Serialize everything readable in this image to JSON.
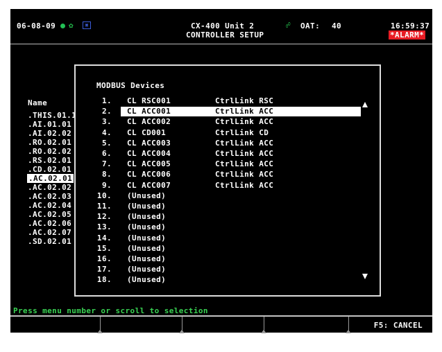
{
  "header": {
    "date": "06-08-09",
    "unit_title": "CX-400 Unit 2",
    "screen_title": "CONTROLLER SETUP",
    "oat_label": "OAT:",
    "oat_value": "40",
    "time": "16:59:37",
    "alarm": "*ALARM*"
  },
  "background": {
    "name_label": "Name",
    "names": [
      ".THIS.01.1",
      ".AI.01.01",
      ".AI.02.02",
      ".RO.02.01",
      ".RO.02.02",
      ".RS.02.01",
      ".CD.02.01",
      ".AC.02.01",
      ".AC.02.02",
      ".AC.02.03",
      ".AC.02.04",
      ".AC.02.05",
      ".AC.02.06",
      ".AC.02.07",
      ".SD.02.01"
    ],
    "selected_index": 7
  },
  "dialog": {
    "title": "MODBUS Devices",
    "selected_index": 1,
    "devices": [
      {
        "num": "1.",
        "name": "CL RSC001",
        "type": "CtrlLink RSC"
      },
      {
        "num": "2.",
        "name": "CL ACC001",
        "type": "CtrlLink ACC"
      },
      {
        "num": "3.",
        "name": "CL ACC002",
        "type": "CtrlLink ACC"
      },
      {
        "num": "4.",
        "name": "CL CD001",
        "type": "CtrlLink CD"
      },
      {
        "num": "5.",
        "name": "CL ACC003",
        "type": "CtrlLink ACC"
      },
      {
        "num": "6.",
        "name": "CL ACC004",
        "type": "CtrlLink ACC"
      },
      {
        "num": "7.",
        "name": "CL ACC005",
        "type": "CtrlLink ACC"
      },
      {
        "num": "8.",
        "name": "CL ACC006",
        "type": "CtrlLink ACC"
      },
      {
        "num": "9.",
        "name": "CL ACC007",
        "type": "CtrlLink ACC"
      },
      {
        "num": "10.",
        "name": "(Unused)",
        "type": ""
      },
      {
        "num": "11.",
        "name": "(Unused)",
        "type": ""
      },
      {
        "num": "12.",
        "name": "(Unused)",
        "type": ""
      },
      {
        "num": "13.",
        "name": "(Unused)",
        "type": ""
      },
      {
        "num": "14.",
        "name": "(Unused)",
        "type": ""
      },
      {
        "num": "15.",
        "name": "(Unused)",
        "type": ""
      },
      {
        "num": "16.",
        "name": "(Unused)",
        "type": ""
      },
      {
        "num": "17.",
        "name": "(Unused)",
        "type": ""
      },
      {
        "num": "18.",
        "name": "(Unused)",
        "type": ""
      }
    ]
  },
  "status_line": "Press menu number or scroll to selection",
  "function_keys": [
    "",
    "",
    "",
    "",
    "",
    "F5: CANCEL"
  ],
  "icons": [
    "status-dot-icon",
    "fan-icon",
    "display-icon",
    "lock-icon",
    "scroll-up-icon",
    "scroll-down-icon"
  ],
  "colors": {
    "alarm": "#e81c24",
    "status_text": "#39d353",
    "indicator": "#22c055"
  }
}
